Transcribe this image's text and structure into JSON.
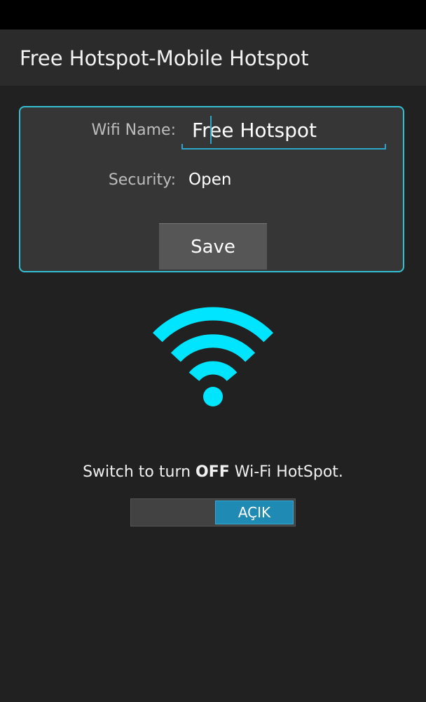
{
  "app": {
    "title": "Free Hotspot-Mobile Hotspot"
  },
  "form": {
    "wifi_name_label": "Wifi Name:",
    "wifi_name_value": "Free Hotspot",
    "security_label": "Security:",
    "security_value": "Open",
    "save_label": "Save"
  },
  "switch": {
    "caption_prefix": "Switch to turn ",
    "caption_bold": "OFF",
    "caption_suffix": " Wi-Fi HotSpot.",
    "state_label": "AÇIK",
    "is_on": true
  },
  "colors": {
    "accent": "#00e5ff",
    "panel_border": "#33c0d4",
    "toggle_on": "#1f8bb4",
    "background": "#212121"
  },
  "icons": {
    "hotspot": "wifi-icon"
  }
}
